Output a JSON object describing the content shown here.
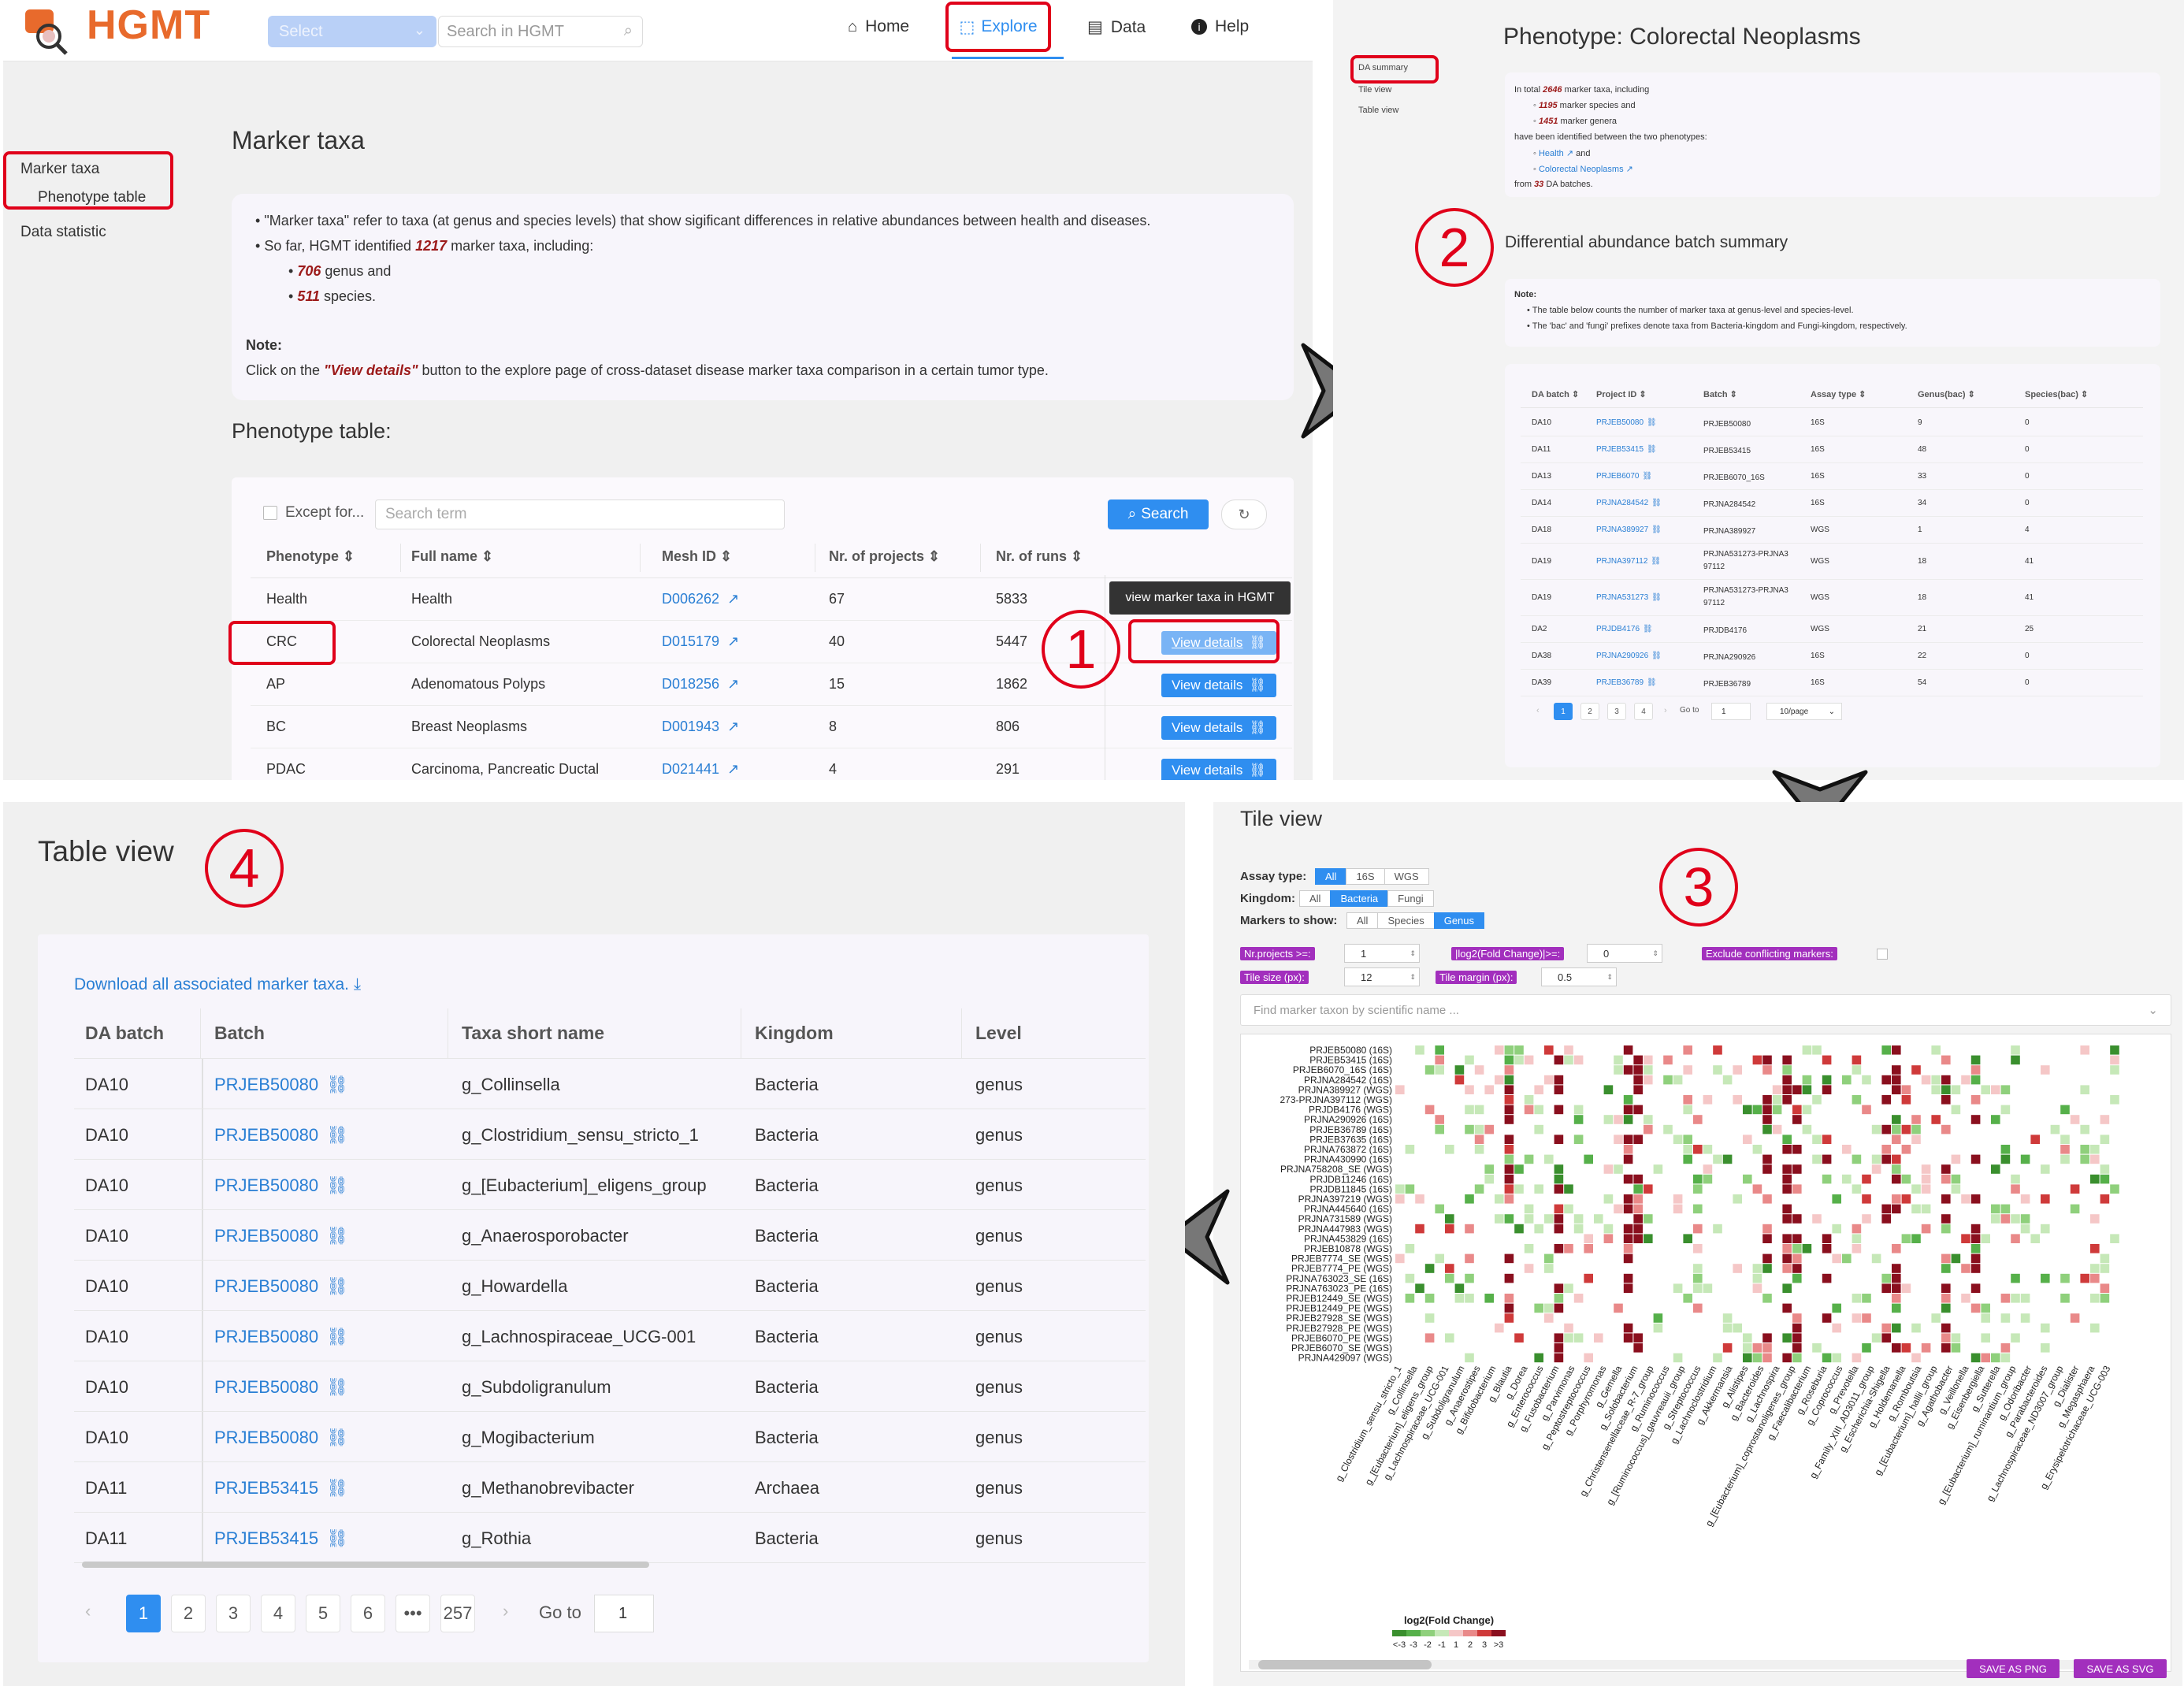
{
  "p1": {
    "logo": "HGMT",
    "select_placeholder": "Select",
    "search_placeholder": "Search in HGMT",
    "nav": {
      "home": "Home",
      "explore": "Explore",
      "data": "Data",
      "help": "Help"
    },
    "side": {
      "marker_taxa": "Marker taxa",
      "phenotype_table": "Phenotype table",
      "data_statistic": "Data statistic"
    },
    "title": "Marker taxa",
    "intro": {
      "b1": "\"Marker taxa\" refer to taxa (at genus and species levels) that show sigificant differences in relative abundances between health and diseases.",
      "b2_pre": "So far, HGMT identified ",
      "b2_num": "1217",
      "b2_post": " marker taxa, including:",
      "s1_num": "706",
      "s1_txt": " genus and",
      "s2_num": "511",
      "s2_txt": " species.",
      "note": "Note:",
      "note_pre": "Click on the ",
      "note_em": "\"View details\"",
      "note_post": " button to the explore page of cross-dataset disease marker taxa comparison in a certain tumor type."
    },
    "pheno_title": "Phenotype table:",
    "except": "Except for...",
    "search_term": "Search term",
    "search_btn": "Search",
    "headers": [
      "Phenotype",
      "Full name",
      "Mesh ID",
      "Nr. of projects",
      "Nr. of runs"
    ],
    "tooltip": "view marker taxa in HGMT",
    "view_details": "View details",
    "rows": [
      {
        "ph": "Health",
        "full": "Health",
        "mesh": "D006262",
        "proj": "67",
        "runs": "5833"
      },
      {
        "ph": "CRC",
        "full": "Colorectal Neoplasms",
        "mesh": "D015179",
        "proj": "40",
        "runs": "5447"
      },
      {
        "ph": "AP",
        "full": "Adenomatous Polyps",
        "mesh": "D018256",
        "proj": "15",
        "runs": "1862"
      },
      {
        "ph": "BC",
        "full": "Breast Neoplasms",
        "mesh": "D001943",
        "proj": "8",
        "runs": "806"
      },
      {
        "ph": "PDAC",
        "full": "Carcinoma, Pancreatic Ductal",
        "mesh": "D021441",
        "proj": "4",
        "runs": "291"
      }
    ],
    "step": "1"
  },
  "p2": {
    "side": {
      "da_summary": "DA summary",
      "tile": "Tile view",
      "table": "Table view"
    },
    "title": "Phenotype: Colorectal Neoplasms",
    "sum": {
      "l1_pre": "In total ",
      "l1_num": "2646",
      "l1_post": " marker taxa, including",
      "l2_num": "1195",
      "l2_txt": " marker species and",
      "l3_num": "1451",
      "l3_txt": " marker genera",
      "l4": "have been identified between the two phenotypes:",
      "l5a": "Health",
      "l5b": " and",
      "l6": "Colorectal Neoplasms",
      "l7_pre": "from ",
      "l7_num": "33",
      "l7_post": " DA batches."
    },
    "step": "2",
    "subtitle": "Differential abundance batch summary",
    "note": "Note:",
    "note1": "The table below counts the number of marker taxa at genus-level and species-level.",
    "note2": "The 'bac' and 'fungi' prefixes denote taxa from Bacteria-kingdom and Fungi-kingdom, respectively.",
    "headers": [
      "DA batch",
      "Project ID",
      "Batch",
      "Assay type",
      "Genus(bac)",
      "Species(bac)"
    ],
    "rows": [
      {
        "da": "DA10",
        "pid": "PRJEB50080",
        "batch": "PRJEB50080",
        "assay": "16S",
        "g": "9",
        "s": "0"
      },
      {
        "da": "DA11",
        "pid": "PRJEB53415",
        "batch": "PRJEB53415",
        "assay": "16S",
        "g": "48",
        "s": "0"
      },
      {
        "da": "DA13",
        "pid": "PRJEB6070",
        "batch": "PRJEB6070_16S",
        "assay": "16S",
        "g": "33",
        "s": "0"
      },
      {
        "da": "DA14",
        "pid": "PRJNA284542",
        "batch": "PRJNA284542",
        "assay": "16S",
        "g": "34",
        "s": "0"
      },
      {
        "da": "DA18",
        "pid": "PRJNA389927",
        "batch": "PRJNA389927",
        "assay": "WGS",
        "g": "1",
        "s": "4"
      },
      {
        "da": "DA19",
        "pid": "PRJNA397112",
        "batch": "PRJNA531273-PRJNA397112",
        "assay": "WGS",
        "g": "18",
        "s": "41"
      },
      {
        "da": "DA19",
        "pid": "PRJNA531273",
        "batch": "PRJNA531273-PRJNA397112",
        "assay": "WGS",
        "g": "18",
        "s": "41"
      },
      {
        "da": "DA2",
        "pid": "PRJDB4176",
        "batch": "PRJDB4176",
        "assay": "WGS",
        "g": "21",
        "s": "25"
      },
      {
        "da": "DA38",
        "pid": "PRJNA290926",
        "batch": "PRJNA290926",
        "assay": "16S",
        "g": "22",
        "s": "0"
      },
      {
        "da": "DA39",
        "pid": "PRJEB36789",
        "batch": "PRJEB36789",
        "assay": "16S",
        "g": "54",
        "s": "0"
      }
    ],
    "pages": [
      "1",
      "2",
      "3",
      "4"
    ],
    "goto": "Go to",
    "goto_val": "1",
    "per_page": "10/page"
  },
  "p3": {
    "title": "Tile view",
    "step": "3",
    "assay_label": "Assay type:",
    "assay": [
      "All",
      "16S",
      "WGS"
    ],
    "kingdom_label": "Kingdom:",
    "kingdom": [
      "All",
      "Bacteria",
      "Fungi"
    ],
    "markers_label": "Markers to show:",
    "markers": [
      "All",
      "Species",
      "Genus"
    ],
    "nr_projects": "Nr.projects >=:",
    "nr_projects_val": "1",
    "log2fc": "|log2(Fold Change)|>=:",
    "log2fc_val": "0",
    "exclude": "Exclude conflicting markers:",
    "tile_size": "Tile size (px):",
    "tile_size_val": "12",
    "tile_margin": "Tile margin (px):",
    "tile_margin_val": "0.5",
    "find_placeholder": "Find marker taxon by scientific name ...",
    "row_labels": [
      "PRJEB50080 (16S)",
      "PRJEB53415 (16S)",
      "PRJEB6070_16S (16S)",
      "PRJNA284542 (16S)",
      "PRJNA389927 (WGS)",
      "273-PRJNA397112 (WGS)",
      "PRJDB4176 (WGS)",
      "PRJNA290926 (16S)",
      "PRJEB36789 (16S)",
      "PRJEB37635 (16S)",
      "PRJNA763872 (16S)",
      "PRJNA430990 (16S)",
      "PRJNA758208_SE (WGS)",
      "PRJDB11246 (16S)",
      "PRJDB11845 (16S)",
      "PRJNA397219 (WGS)",
      "PRJNA445640 (16S)",
      "PRJNA731589 (WGS)",
      "PRJNA447983 (WGS)",
      "PRJNA453829 (16S)",
      "PRJEB10878 (WGS)",
      "PRJEB7774_SE (WGS)",
      "PRJEB7774_PE (WGS)",
      "PRJNA763023_SE (16S)",
      "PRJNA763023_PE (16S)",
      "PRJEB12449_SE (WGS)",
      "PRJEB12449_PE (WGS)",
      "PRJEB27928_SE (WGS)",
      "PRJEB27928_PE (WGS)",
      "PRJEB6070_PE (WGS)",
      "PRJEB6070_SE (WGS)",
      "PRJNA429097 (WGS)"
    ],
    "col_labels": [
      "g_Clostridium_sensu_stricto_1",
      "g_Collinsella",
      "g_[Eubacterium]_eligens_group",
      "g_Lachnospiraceae_UCG-001",
      "g_Subdoligranulum",
      "g_Anaerostipes",
      "g_Bifidobacterium",
      "g_Blautia",
      "g_Dorea",
      "g_Enterococcus",
      "g_Fusobacterium",
      "g_Parvimonas",
      "g_Peptostreptococcus",
      "g_Porphyromonas",
      "g_Gemella",
      "g_Solobacterium",
      "g_Christensenellaceae_R-7_group",
      "g_Ruminococcus",
      "g_[Ruminococcus]_gauvreauii_group",
      "g_Streptococcus",
      "g_Lachnoclostridium",
      "g_Akkermansia",
      "g_Alistipes",
      "g_Bacteroides",
      "g_Lachnospira",
      "g_[Eubacterium]_coprostanoligenes_group",
      "g_Faecalibacterium",
      "g_Roseburia",
      "g_Coprococcus",
      "g_Prevotella",
      "g_Family_XIII_AD3011_group",
      "g_Escherichia-Shigella",
      "g_Holdemanella",
      "g_Romboutsia",
      "g_[Eubacterium]_hallii_group",
      "g_Agathobacter",
      "g_Veillonella",
      "g_Eisenbergiella",
      "g_Sutterella",
      "g_[Eubacterium]_ruminantium_group",
      "g_Odoribacter",
      "g_Parabacteroides",
      "g_Lachnospiraceae_ND3007_group",
      "g_Dialister",
      "g_Megasphaera",
      "g_Erysipelotrichaceae_UCG-003"
    ],
    "legend_title": "log2(Fold Change)",
    "legend_labels": [
      "<-3",
      "-3",
      "-2",
      "-1",
      "1",
      "2",
      "3",
      ">3"
    ],
    "legend_colors": [
      "#3a8f2e",
      "#56b04a",
      "#8fd07c",
      "#c6e8b8",
      "#f5c7c7",
      "#e98989",
      "#cf3a3a",
      "#8a0f1e"
    ],
    "save_png": "SAVE AS PNG",
    "save_svg": "SAVE AS SVG"
  },
  "p4": {
    "title": "Table view",
    "step": "4",
    "download": "Download all associated marker taxa.",
    "headers": [
      "DA batch",
      "Batch",
      "Taxa short name",
      "Kingdom",
      "Level"
    ],
    "rows": [
      {
        "da": "DA10",
        "batch": "PRJEB50080",
        "taxa": "g_Collinsella",
        "kingdom": "Bacteria",
        "level": "genus"
      },
      {
        "da": "DA10",
        "batch": "PRJEB50080",
        "taxa": "g_Clostridium_sensu_stricto_1",
        "kingdom": "Bacteria",
        "level": "genus"
      },
      {
        "da": "DA10",
        "batch": "PRJEB50080",
        "taxa": "g_[Eubacterium]_eligens_group",
        "kingdom": "Bacteria",
        "level": "genus"
      },
      {
        "da": "DA10",
        "batch": "PRJEB50080",
        "taxa": "g_Anaerosporobacter",
        "kingdom": "Bacteria",
        "level": "genus"
      },
      {
        "da": "DA10",
        "batch": "PRJEB50080",
        "taxa": "g_Howardella",
        "kingdom": "Bacteria",
        "level": "genus"
      },
      {
        "da": "DA10",
        "batch": "PRJEB50080",
        "taxa": "g_Lachnospiraceae_UCG-001",
        "kingdom": "Bacteria",
        "level": "genus"
      },
      {
        "da": "DA10",
        "batch": "PRJEB50080",
        "taxa": "g_Subdoligranulum",
        "kingdom": "Bacteria",
        "level": "genus"
      },
      {
        "da": "DA10",
        "batch": "PRJEB50080",
        "taxa": "g_Mogibacterium",
        "kingdom": "Bacteria",
        "level": "genus"
      },
      {
        "da": "DA11",
        "batch": "PRJEB53415",
        "taxa": "g_Methanobrevibacter",
        "kingdom": "Archaea",
        "level": "genus"
      },
      {
        "da": "DA11",
        "batch": "PRJEB53415",
        "taxa": "g_Rothia",
        "kingdom": "Bacteria",
        "level": "genus"
      }
    ],
    "pages": [
      "1",
      "2",
      "3",
      "4",
      "5",
      "6",
      "•••",
      "257"
    ],
    "goto": "Go to",
    "goto_val": "1"
  },
  "colors": {
    "red_marker": "#e0001a",
    "accent": "#2f8ef0",
    "link": "#2a7fd4",
    "logo": "#e86a2c",
    "em": "#9c1a1a",
    "purple_tag": "#a22fbd"
  }
}
